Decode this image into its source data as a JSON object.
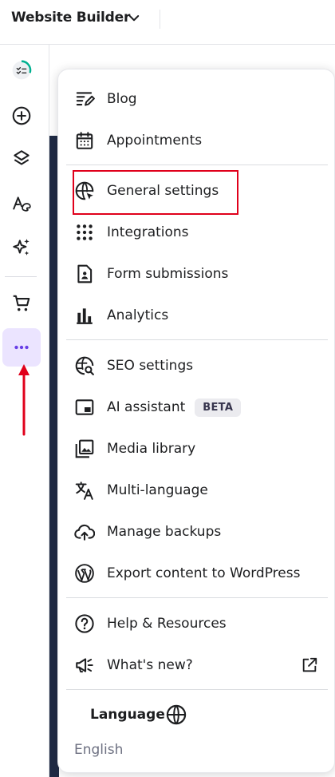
{
  "header": {
    "title": "Website Builder"
  },
  "menu": {
    "items": [
      {
        "label": "Blog",
        "icon": "blog-edit-icon"
      },
      {
        "label": "Appointments",
        "icon": "calendar-icon"
      },
      {
        "label": "General settings",
        "icon": "globe-cursor-icon"
      },
      {
        "label": "Integrations",
        "icon": "grid-dots-icon"
      },
      {
        "label": "Form submissions",
        "icon": "form-document-icon"
      },
      {
        "label": "Analytics",
        "icon": "bar-chart-icon"
      },
      {
        "label": "SEO settings",
        "icon": "seo-globe-search-icon"
      },
      {
        "label": "AI assistant",
        "icon": "ai-window-icon",
        "badge": "BETA"
      },
      {
        "label": "Media library",
        "icon": "image-library-icon"
      },
      {
        "label": "Multi-language",
        "icon": "translate-icon"
      },
      {
        "label": "Manage backups",
        "icon": "cloud-backup-icon"
      },
      {
        "label": "Export content to WordPress",
        "icon": "wordpress-icon"
      },
      {
        "label": "Help & Resources",
        "icon": "help-circle-icon"
      },
      {
        "label": "What's new?",
        "icon": "megaphone-icon"
      }
    ],
    "language": {
      "title": "Language",
      "value": "English"
    }
  },
  "colors": {
    "accent": "#673de6",
    "active_bg": "#ebe4ff",
    "annotation": "#e0001b",
    "text": "#1d1e20",
    "muted": "#6d7081"
  }
}
